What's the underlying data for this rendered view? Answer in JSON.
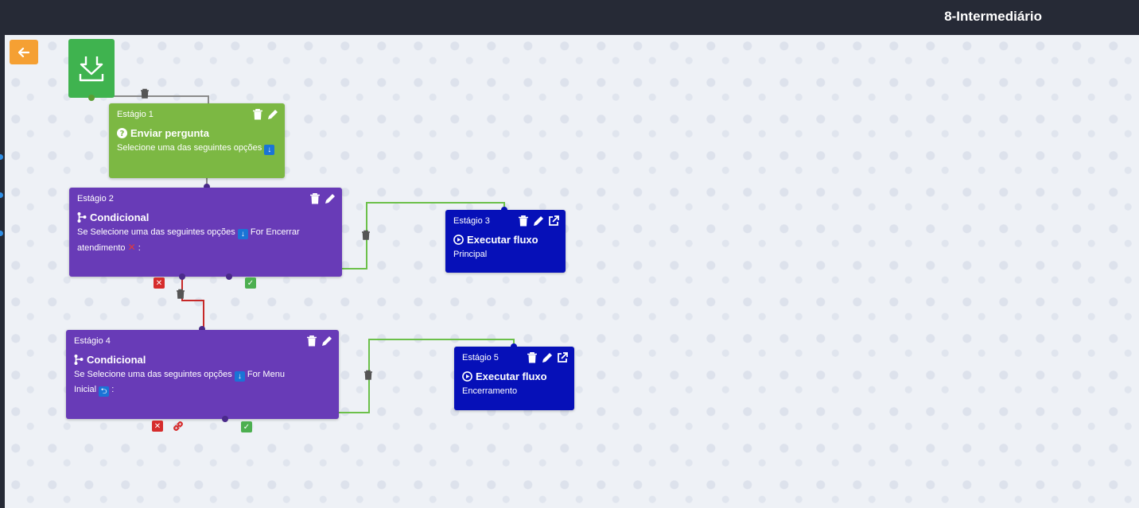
{
  "header": {
    "title": "8-Intermediário"
  },
  "colors": {
    "topbar": "#262a36",
    "stage_green": "#7cb843",
    "stage_purple": "#683bb7",
    "stage_blue": "#0610b8",
    "start_green": "#3fb34f",
    "back_orange": "#f5a033",
    "wire_green": "#6cc04a",
    "wire_red": "#c62828",
    "wire_gray": "#8a8a8a"
  },
  "stages": [
    {
      "stage": "Estágio 1",
      "type": "Enviar pergunta",
      "icon": "question-circle-icon",
      "desc": "Selecione uma das seguintes opções"
    },
    {
      "stage": "Estágio 2",
      "type": "Condicional",
      "icon": "branch-icon",
      "desc_line1": "Se Selecione uma das seguintes opções",
      "desc_mid": "For Encerrar",
      "desc_line2": "atendimento",
      "desc_end": ":"
    },
    {
      "stage": "Estágio 3",
      "type": "Executar fluxo",
      "icon": "play-circle-icon",
      "desc": "Principal"
    },
    {
      "stage": "Estágio 4",
      "type": "Condicional",
      "icon": "branch-icon",
      "desc_line1": "Se Selecione uma das seguintes opções",
      "desc_mid": "For Menu",
      "desc_line2": "Inicial",
      "desc_end": ":"
    },
    {
      "stage": "Estágio 5",
      "type": "Executar fluxo",
      "icon": "play-circle-icon",
      "desc": "Encerramento"
    }
  ]
}
